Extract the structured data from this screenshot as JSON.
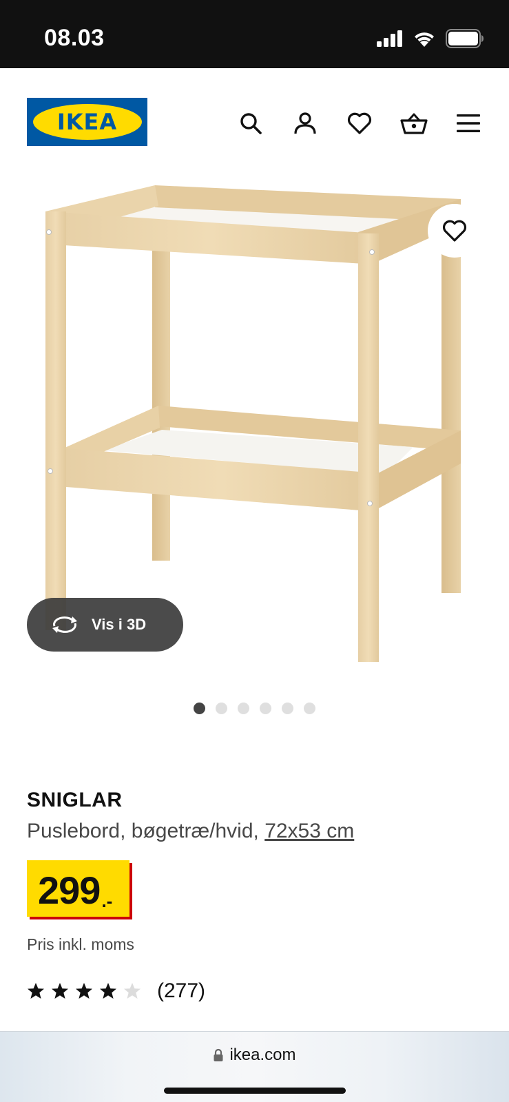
{
  "status": {
    "time": "08.03"
  },
  "header": {
    "logo_text": "IKEA",
    "icons": [
      "search-icon",
      "account-icon",
      "wishlist-icon",
      "cart-icon",
      "menu-icon"
    ]
  },
  "gallery": {
    "view3d_label": "Vis i 3D",
    "image_count": 6,
    "active_index": 0
  },
  "product": {
    "name": "SNIGLAR",
    "description": "Puslebord, bøgetræ/hvid, ",
    "size": "72x53 cm",
    "price_integer": "299",
    "price_decimal": ".-",
    "price_note": "Pris inkl. moms",
    "rating_value": 4,
    "rating_max": 5,
    "review_count": "(277)"
  },
  "browser": {
    "url": "ikea.com"
  },
  "colors": {
    "ikea_blue": "#0058a3",
    "ikea_yellow": "#ffdb00",
    "price_red": "#cc0008"
  }
}
